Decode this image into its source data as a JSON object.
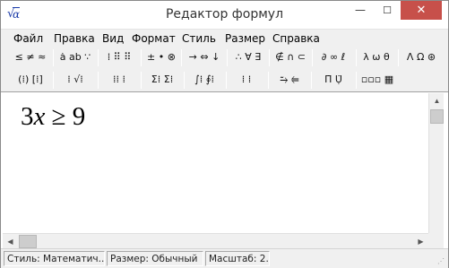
{
  "window": {
    "title": "Редактор формул",
    "app_icon_radical": "√",
    "app_icon_letter": "α",
    "minimize_glyph": "—",
    "maximize_glyph": "☐",
    "close_glyph": "✕"
  },
  "menu": [
    {
      "label": "Файл"
    },
    {
      "label": "Правка"
    },
    {
      "label": "Вид"
    },
    {
      "label": "Формат"
    },
    {
      "label": "Стиль"
    },
    {
      "label": "Размер"
    },
    {
      "label": "Справка"
    }
  ],
  "toolbar_row1": [
    {
      "name": "relations-palette",
      "label": "≤ ≠ ≈"
    },
    {
      "name": "spaces-palette",
      "label": "ȧ ab ∵"
    },
    {
      "name": "embellishments-palette",
      "label": "⁞ ⠿ ⠿"
    },
    {
      "name": "operators-palette",
      "label": "± • ⊗"
    },
    {
      "name": "arrows-palette",
      "label": "→ ⇔ ↓"
    },
    {
      "name": "logic-palette",
      "label": "∴ ∀ ∃"
    },
    {
      "name": "set-theory-palette",
      "label": "∉ ∩ ⊂"
    },
    {
      "name": "misc-symbols-palette",
      "label": "∂ ∞ ℓ"
    },
    {
      "name": "greek-lowercase-palette",
      "label": "λ ω θ"
    },
    {
      "name": "greek-uppercase-palette",
      "label": "Λ Ω ⊛"
    }
  ],
  "toolbar_row2": [
    {
      "name": "fences-palette",
      "label": "(⁞) [⁞]"
    },
    {
      "name": "fractions-radicals-palette",
      "label": "⁞ √⁞"
    },
    {
      "name": "subscripts-palette",
      "label": "⁞⁞ ⁞"
    },
    {
      "name": "summation-palette",
      "label": "Σ⁞ Σ⁞"
    },
    {
      "name": "integrals-palette",
      "label": "∫⁞ ∮⁞"
    },
    {
      "name": "underbars-palette",
      "label": "⁞ ⁞"
    },
    {
      "name": "labeled-arrows-palette",
      "label": "⥲ ⥢"
    },
    {
      "name": "products-palette",
      "label": "Π̈ Ụ̈"
    },
    {
      "name": "matrices-palette",
      "label": "▫▫▫ ▦"
    }
  ],
  "formula": {
    "coefficient": "3",
    "variable": "x",
    "relation": "≥",
    "value": "9"
  },
  "scroll_glyphs": {
    "up": "▲",
    "left": "◀",
    "right": "▶"
  },
  "status": {
    "style": "Стиль: Математич...",
    "size": "Размер: Обычный",
    "zoom": "Масштаб: 2..."
  }
}
